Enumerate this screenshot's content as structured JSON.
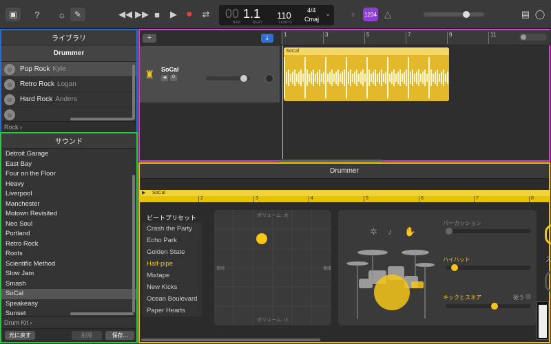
{
  "toolbar": {
    "position": {
      "bar": "00",
      "beat": "1.1"
    },
    "bar_label": "BAR",
    "beat_label": "BEAT",
    "tempo": "110",
    "tempo_label": "TEMPO",
    "time_signature": "4/4",
    "key": "Cmaj",
    "count_in": "1234",
    "master_volume": 0.73
  },
  "library": {
    "title": "ライブラリ",
    "subtitle": "Drummer",
    "drummers": [
      {
        "style": "Pop Rock",
        "name": "Kyle"
      },
      {
        "style": "Retro Rock",
        "name": "Logan"
      },
      {
        "style": "Hard Rock",
        "name": "Anders"
      },
      {
        "style": "",
        "name": ""
      }
    ],
    "genre": "Rock"
  },
  "sound": {
    "title": "サウンド",
    "items": [
      "Detroit Garage",
      "East Bay",
      "Four on the Floor",
      "Heavy",
      "Liverpool",
      "Manchester",
      "Motown Revisited",
      "Neo Soul",
      "Portland",
      "Retro Rock",
      "Roots",
      "Scientific Method",
      "Slow Jam",
      "Smash",
      "SoCal",
      "Speakeasy",
      "Sunset"
    ],
    "selected": "SoCal",
    "kit": "Drum Kit",
    "revert_label": "元に戻す",
    "delete_label": "削除",
    "save_label": "保存..."
  },
  "tracks": {
    "add_label": "+",
    "ruler": [
      "1",
      "3",
      "5",
      "7",
      "9",
      "11"
    ],
    "track_name": "SoCal",
    "region_name": "SoCal"
  },
  "editor": {
    "title": "Drummer",
    "region_label": "SoCal",
    "ruler": [
      "2",
      "3",
      "4",
      "5",
      "6",
      "7",
      "8"
    ],
    "presets_title": "ビートプリセット",
    "presets": [
      "Crash the Party",
      "Echo Park",
      "Golden State",
      "Half-pipe",
      "Mixtape",
      "New Kicks",
      "Ocean Boulevard",
      "Paper Hearts"
    ],
    "selected_preset": "Half-pipe",
    "xy_top": "ボリューム: 大",
    "xy_bottom": "ボリューム: 小",
    "xy_left": "単純",
    "xy_right": "複雑",
    "percussion_label": "パーカッション",
    "hihat_label": "ハイハット",
    "kicksnare_label": "キックとスネア",
    "follow_label": "従う",
    "right_cut": "ス"
  },
  "colors": {
    "accent": "#f5c518",
    "library_border": "#1f6fe0",
    "sound_border": "#27c93f",
    "tracks_border": "#d53fd8",
    "editor_border": "#e8c400"
  }
}
